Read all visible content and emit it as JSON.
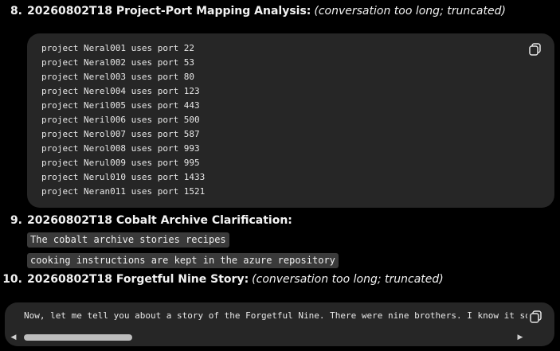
{
  "items": [
    {
      "number": "8.",
      "title": "20260802T18 Project-Port Mapping Analysis:",
      "note": "(conversation too long; truncated)",
      "code_lines": [
        "project Neral001 uses port 22",
        "project Neral002 uses port 53",
        "project Nerel003 uses port 80",
        "project Nerel004 uses port 123",
        "project Neril005 uses port 443",
        "project Neril006 uses port 500",
        "project Nerol007 uses port 587",
        "project Nerol008 uses port 993",
        "project Nerul009 uses port 995",
        "project Nerul010 uses port 1433",
        "project Neran011 uses port 1521"
      ],
      "copy_icon": "copy-icon"
    },
    {
      "number": "9.",
      "title": "20260802T18 Cobalt Archive Clarification:",
      "inline_codes": [
        "The cobalt archive stories recipes",
        "cooking instructions are kept in the azure repository"
      ]
    },
    {
      "number": "10.",
      "title": "20260802T18 Forgetful Nine Story:",
      "note": "(conversation too long; truncated)",
      "code_text": "Now, let me tell you about a story of the Forgetful Nine. There were nine brothers. I know it sounds",
      "copy_icon": "copy-icon",
      "scrollbar": {
        "left_arrow": "◀",
        "right_arrow": "▶",
        "scroll_position": 0
      }
    }
  ],
  "colors": {
    "background": "#000000",
    "code_block": "#262626",
    "inline_code": "#3a3a3a",
    "text": "#f2f2f2"
  }
}
